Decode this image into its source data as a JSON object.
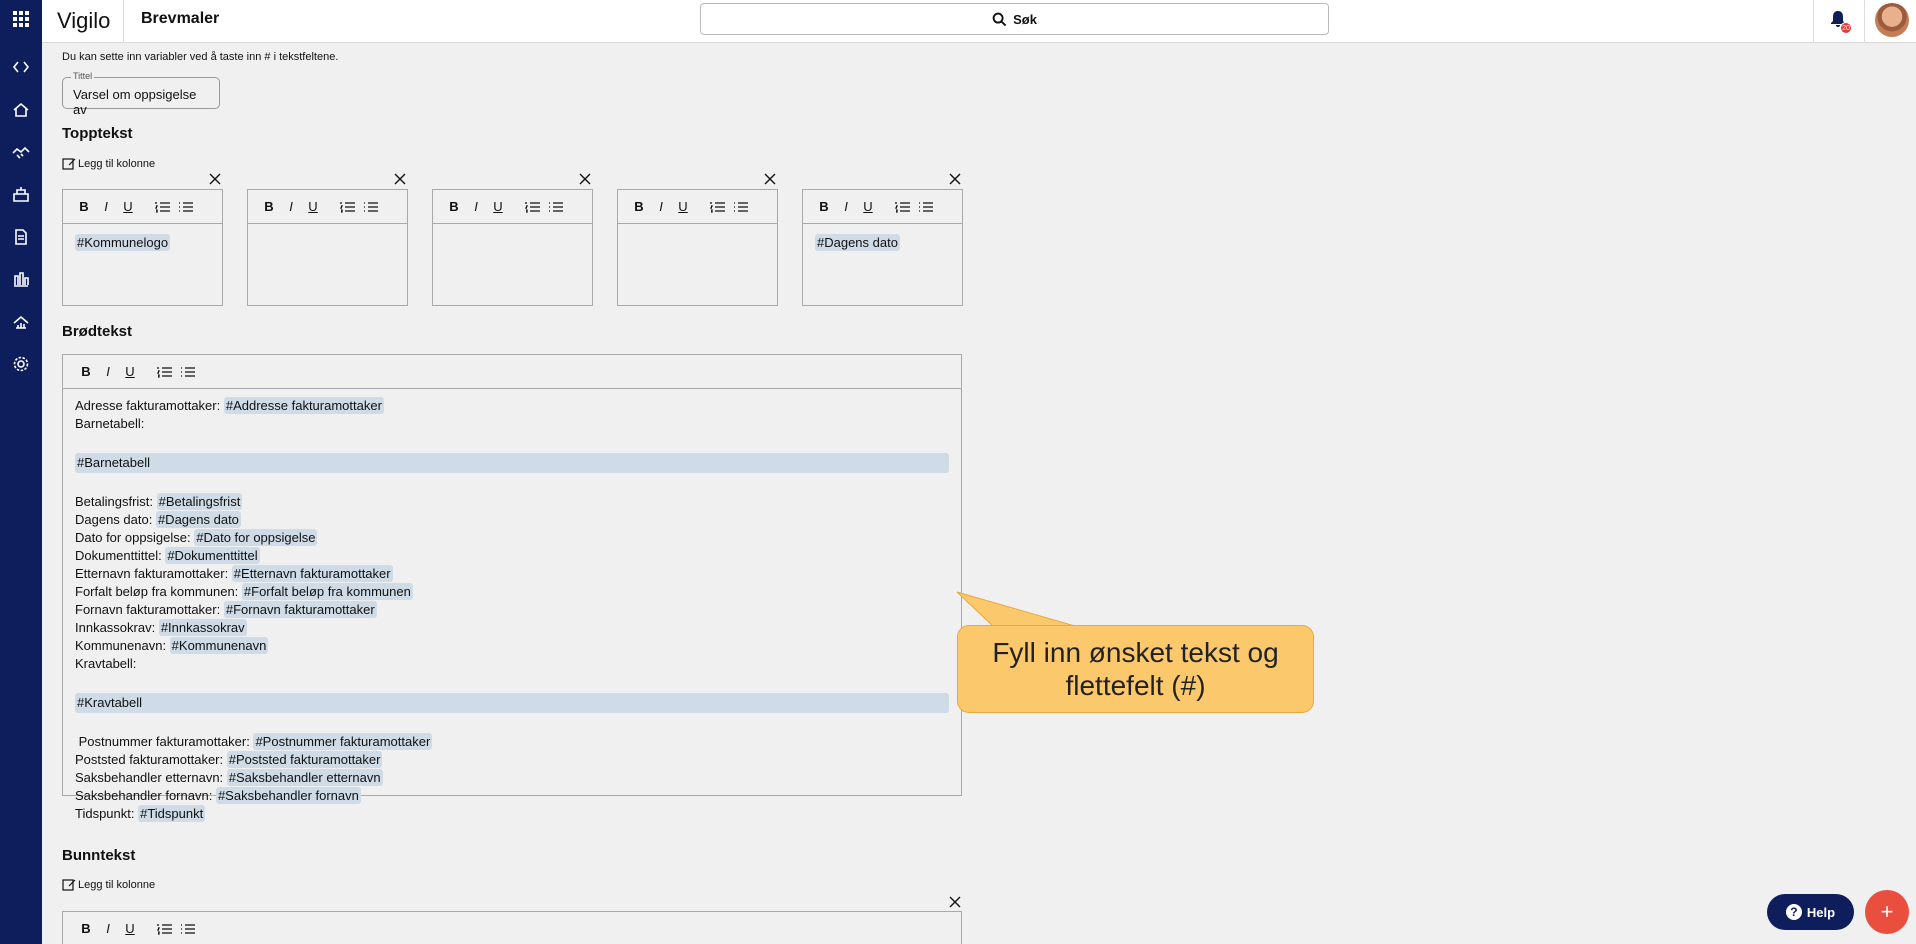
{
  "app": {
    "brand": "Vigilo",
    "page_title": "Brevmaler"
  },
  "search": {
    "label": "Søk"
  },
  "notifications": {
    "count": "20"
  },
  "hint": "Du kan sette inn variabler ved å taste inn # i tekstfeltene.",
  "title_field": {
    "label": "Tittel",
    "value": "Varsel om oppsigelse av"
  },
  "header_section": {
    "heading": "Topptekst",
    "add_column": "Legg til kolonne",
    "columns": [
      {
        "content": "#Kommunelogo"
      },
      {
        "content": ""
      },
      {
        "content": ""
      },
      {
        "content": ""
      },
      {
        "content": "#Dagens dato"
      }
    ]
  },
  "toolbar": {
    "bold": "B",
    "italic": "I",
    "underline": "U"
  },
  "body_section": {
    "heading": "Brødtekst",
    "lines": [
      {
        "label": "Adresse fakturamottaker: ",
        "tag": "#Addresse fakturamottaker"
      },
      {
        "label": "Barnetabell:",
        "tag": ""
      },
      {
        "label": "",
        "tag": ""
      },
      {
        "label": "",
        "tag": "#Barnetabell",
        "block": true
      },
      {
        "label": "",
        "tag": ""
      },
      {
        "label": "Betalingsfrist: ",
        "tag": "#Betalingsfrist"
      },
      {
        "label": "Dagens dato: ",
        "tag": "#Dagens dato"
      },
      {
        "label": "Dato for oppsigelse: ",
        "tag": "#Dato for oppsigelse"
      },
      {
        "label": "Dokumenttittel: ",
        "tag": "#Dokumenttittel"
      },
      {
        "label": "Etternavn fakturamottaker: ",
        "tag": "#Etternavn fakturamottaker"
      },
      {
        "label": "Forfalt beløp fra kommunen: ",
        "tag": "#Forfalt beløp fra kommunen"
      },
      {
        "label": "Fornavn fakturamottaker: ",
        "tag": "#Fornavn fakturamottaker"
      },
      {
        "label": "Innkassokrav: ",
        "tag": "#Innkassokrav"
      },
      {
        "label": "Kommunenavn: ",
        "tag": "#Kommunenavn"
      },
      {
        "label": "Kravtabell:",
        "tag": ""
      },
      {
        "label": "",
        "tag": ""
      },
      {
        "label": "",
        "tag": "#Kravtabell",
        "block": true
      },
      {
        "label": "",
        "tag": ""
      },
      {
        "label": " Postnummer fakturamottaker: ",
        "tag": "#Postnummer fakturamottaker"
      },
      {
        "label": "Poststed fakturamottaker: ",
        "tag": "#Poststed fakturamottaker"
      },
      {
        "label": "Saksbehandler etternavn: ",
        "tag": "#Saksbehandler etternavn"
      },
      {
        "label": "Saksbehandler fornavn: ",
        "tag": "#Saksbehandler fornavn"
      },
      {
        "label": "Tidspunkt: ",
        "tag": "#Tidspunkt"
      }
    ]
  },
  "footer_section": {
    "heading": "Bunntekst",
    "add_column": "Legg til kolonne"
  },
  "callout": {
    "text": "Fyll inn ønsket tekst og flettefelt (#)",
    "color": "#fcc86c"
  },
  "help_button": {
    "label": "Help"
  },
  "fab": {
    "label": "+"
  },
  "colors": {
    "rail": "#0e1d5c",
    "tag": "#cfdbe6",
    "fab": "#e94e3e"
  }
}
